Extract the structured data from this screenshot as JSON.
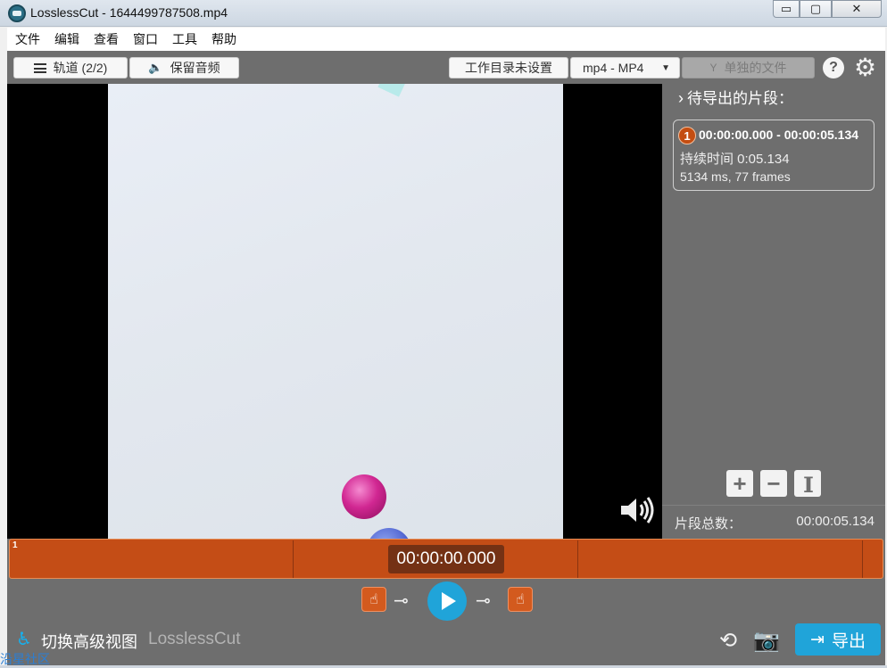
{
  "window": {
    "title": "LosslessCut - 1644499787508.mp4",
    "controls": {
      "minimize": "▭",
      "maximize": "▢",
      "close": "✕"
    }
  },
  "menubar": {
    "items": [
      "文件",
      "编辑",
      "查看",
      "窗口",
      "工具",
      "帮助"
    ]
  },
  "topbar": {
    "tracks_label": "轨道 (2/2)",
    "keep_audio_label": "保留音频",
    "workdir_label": "工作目录未设置",
    "format_label": "mp4 - MP4",
    "separate_files_label": "单独的文件",
    "help_label": "?"
  },
  "sidebar": {
    "title": "待导出的片段：",
    "segment": {
      "number": "1",
      "range": "00:00:00.000 - 00:00:05.134",
      "duration": "持续时间 0:05.134",
      "info": "5134 ms, 77 frames"
    },
    "total_label": "片段总数：",
    "total_value": "00:00:05.134"
  },
  "timeline": {
    "segment_number": "1",
    "current_time": "00:00:00.000"
  },
  "bottombar": {
    "advanced_view_label": "切换高级视图",
    "brand": "LosslessCut",
    "export_label": "导出"
  },
  "watermark": "沿星社区",
  "colors": {
    "accent": "#20a4d9",
    "segment": "#c44d16",
    "panel": "#6e6e6e"
  },
  "icons": [
    "menu-icon",
    "speaker-icon",
    "chevron-down-icon",
    "merge-icon",
    "help-icon",
    "gear-icon",
    "chevron-right-icon",
    "plus-icon",
    "minus-icon",
    "split-icon",
    "cut-start-icon",
    "key-prev-icon",
    "play-icon",
    "key-next-icon",
    "cut-end-icon",
    "advanced-view-icon",
    "rotate-icon",
    "camera-icon",
    "export-icon",
    "volume-icon"
  ]
}
